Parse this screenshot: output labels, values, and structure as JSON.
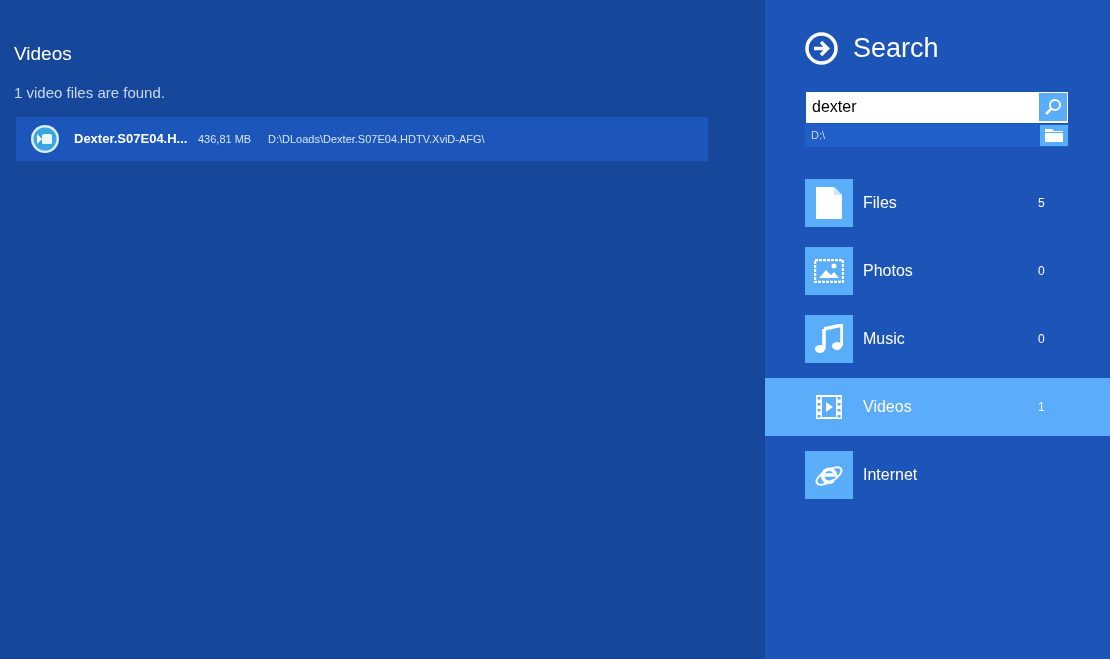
{
  "results": {
    "title": "Videos",
    "summary": "1 video files are found.",
    "rows": [
      {
        "name": "Dexter.S07E04.H...",
        "size": "436,81 MB",
        "path": "D:\\DLoads\\Dexter.S07E04.HDTV.XviD-AFG\\",
        "selected": true
      }
    ]
  },
  "search": {
    "title": "Search",
    "query": "dexter",
    "location": "D:\\"
  },
  "categories": [
    {
      "kind": "files",
      "label": "Files",
      "count": "5",
      "selected": false
    },
    {
      "kind": "photos",
      "label": "Photos",
      "count": "0",
      "selected": false
    },
    {
      "kind": "music",
      "label": "Music",
      "count": "0",
      "selected": false
    },
    {
      "kind": "videos",
      "label": "Videos",
      "count": "1",
      "selected": true
    },
    {
      "kind": "internet",
      "label": "Internet",
      "selected": false
    }
  ]
}
